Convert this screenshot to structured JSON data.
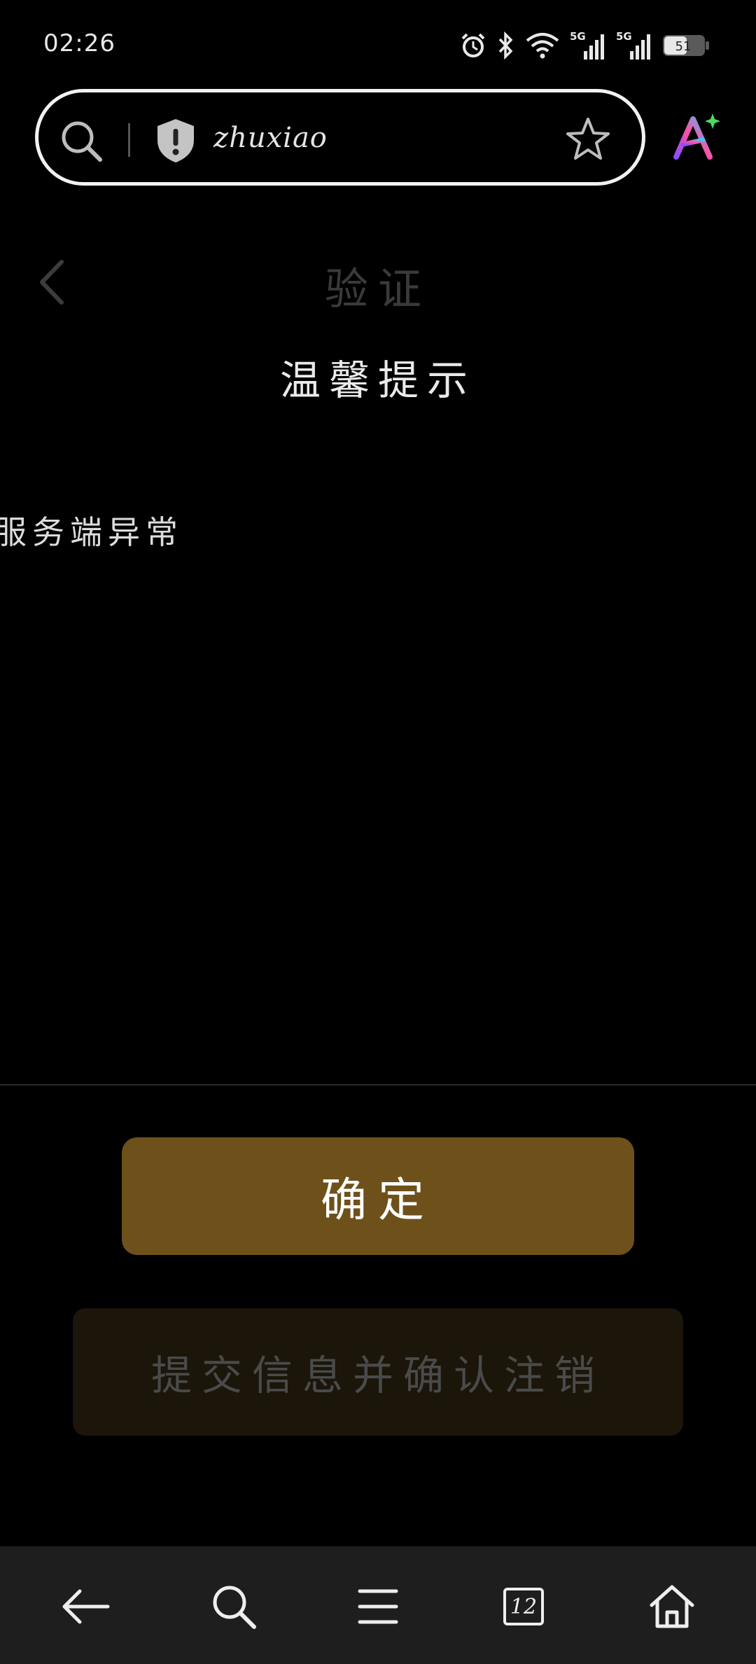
{
  "status_bar": {
    "time": "02:26",
    "battery_level": "51",
    "network_1": "5G",
    "network_2": "5G"
  },
  "browser": {
    "url": "zhuxiao",
    "tab_count": "12"
  },
  "page": {
    "title": "验证"
  },
  "dialog": {
    "title": "温馨提示",
    "message": "服务端异常",
    "confirm_label": "确定"
  },
  "actions": {
    "submit_label": "提交信息并确认注销"
  },
  "colors": {
    "confirm_bg": "#6e501b",
    "submit_bg": "#1b150a"
  }
}
